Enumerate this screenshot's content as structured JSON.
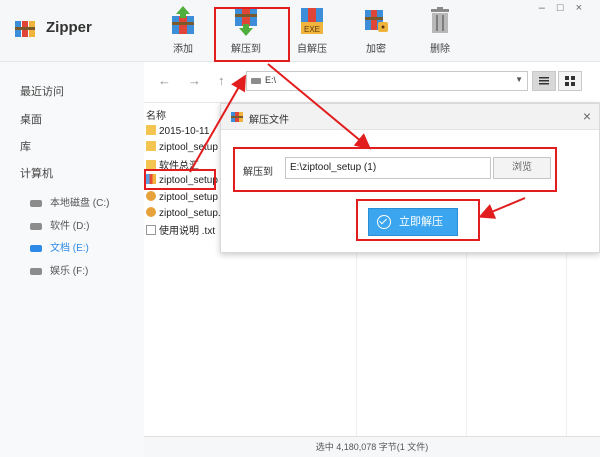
{
  "app": {
    "title": "Zipper"
  },
  "toolbar": {
    "add": "添加",
    "extract_to": "解压到",
    "self_extract": "自解压",
    "encrypt": "加密",
    "delete": "删除",
    "exe_badge": "EXE"
  },
  "window_controls": {
    "minimize": "–",
    "maximize": "□",
    "close": "×"
  },
  "sidebar": {
    "recent": "最近访问",
    "desktop": "桌面",
    "library": "库",
    "computer": "计算机",
    "drives": [
      {
        "label": "本地磁盘 (C:)"
      },
      {
        "label": "软件 (D:)"
      },
      {
        "label": "文档 (E:)"
      },
      {
        "label": "娱乐 (F:)"
      }
    ]
  },
  "nav": {
    "back": "←",
    "forward": "→",
    "up": "↑",
    "path": "E:\\",
    "dropdown": "▼"
  },
  "file_list": {
    "column_name": "名称",
    "rows": [
      {
        "name": "2015-10-11",
        "icon": "folder-icon"
      },
      {
        "name": "ziptool_setup",
        "icon": "folder-icon"
      },
      {
        "name": "软件总汇",
        "icon": "folder-icon"
      },
      {
        "name": "ziptool_setup",
        "icon": "rar-icon"
      },
      {
        "name": "ziptool_setup",
        "icon": "zip-icon"
      },
      {
        "name": "ziptool_setup.",
        "icon": "zip-icon"
      },
      {
        "name": "使用说明 .txt",
        "icon": "txt-icon"
      }
    ]
  },
  "status": {
    "text": "选中  4,180,078 字节(1 文件)"
  },
  "dialog": {
    "title": "解压文件",
    "close": "×",
    "extract_to_label": "解压到",
    "path_value": "E:\\ziptool_setup (1)",
    "browse": "浏览",
    "extract_now": "立即解压"
  },
  "colors": {
    "accent": "#3ba6ef",
    "annotation": "#e21d1d",
    "active_drive": "#2e8ae6"
  }
}
